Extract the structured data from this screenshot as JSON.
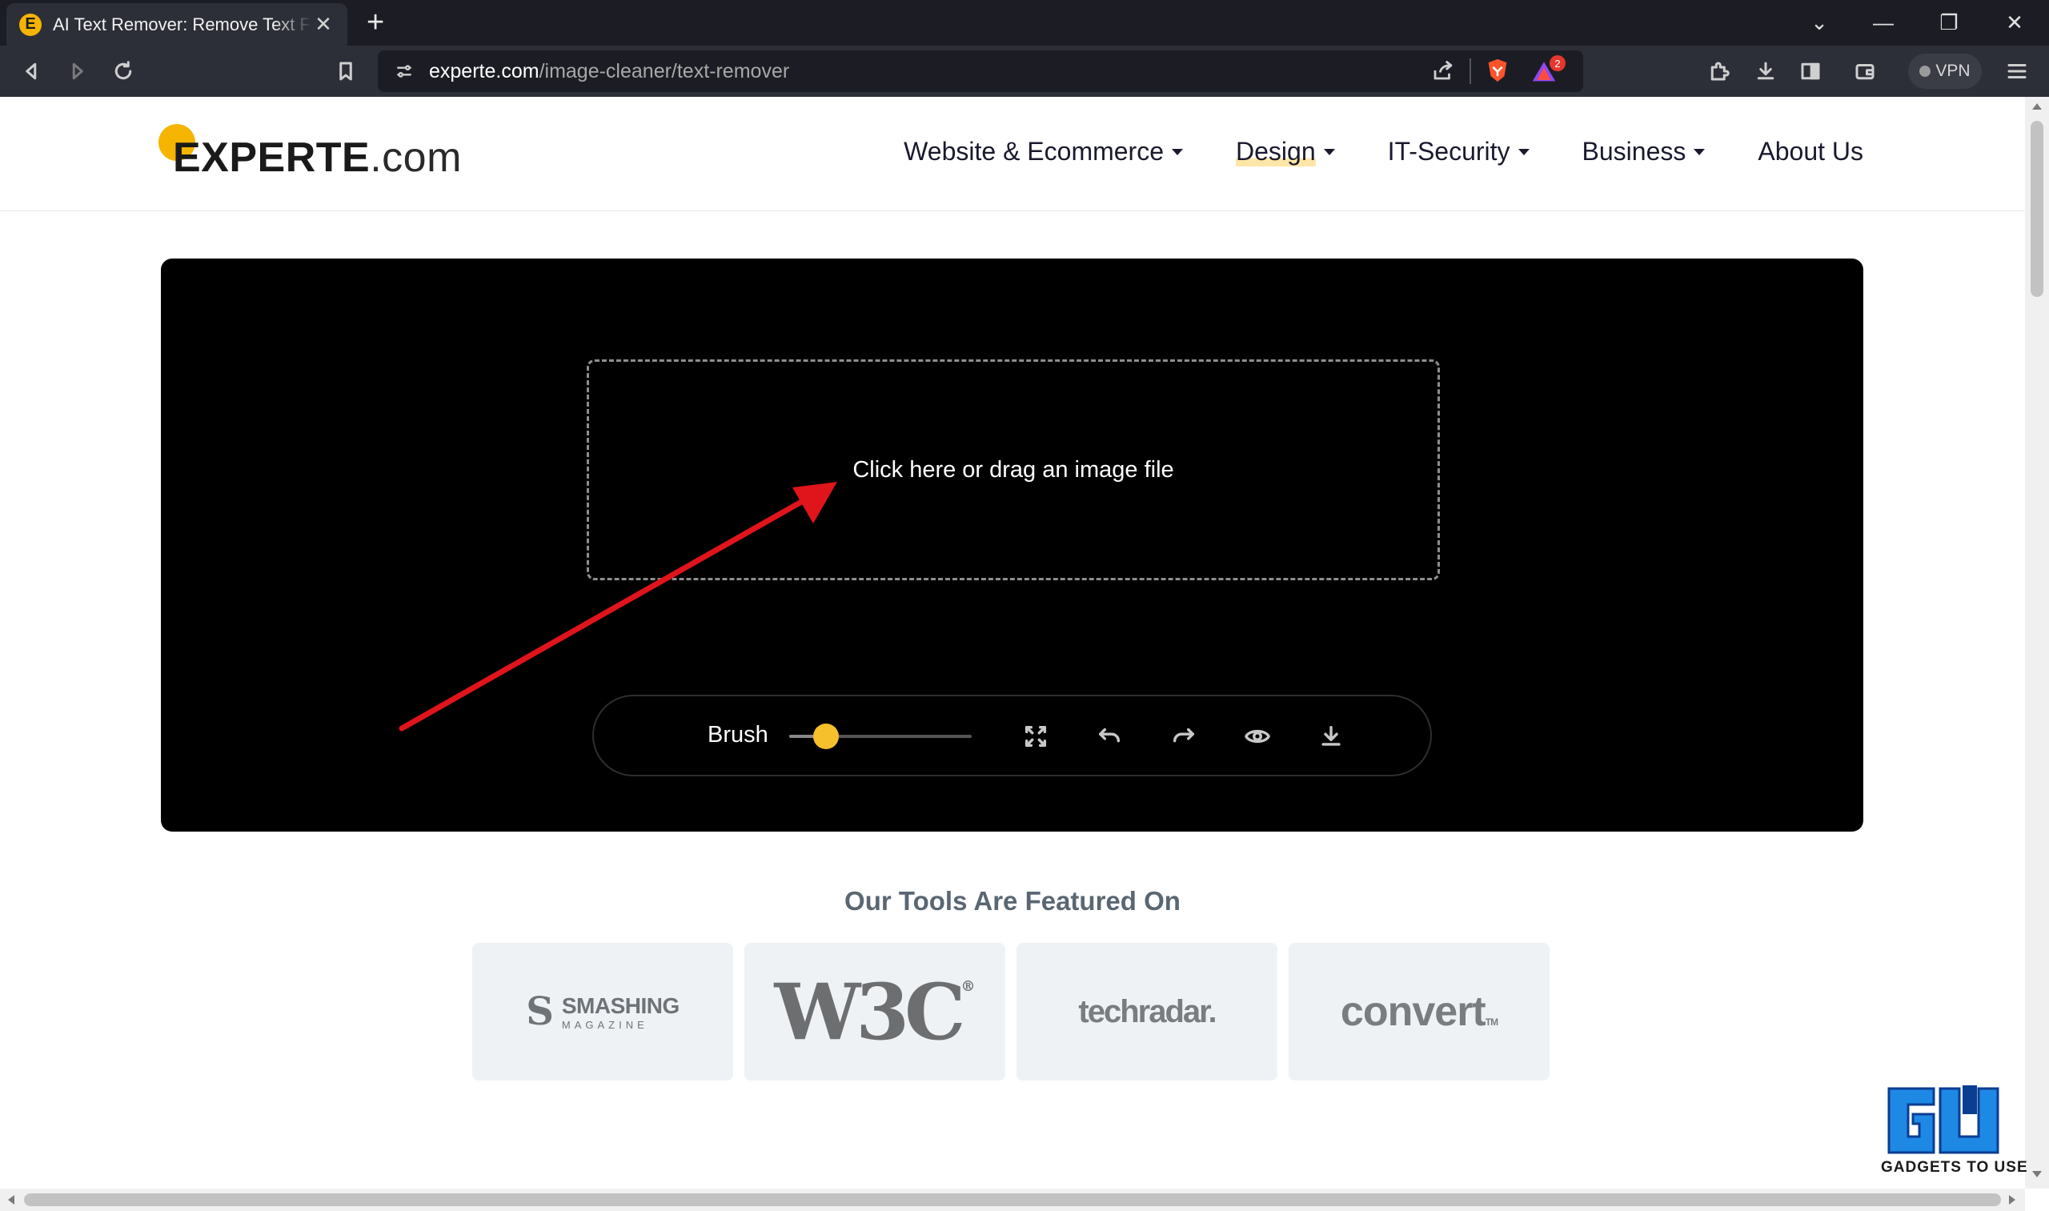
{
  "browser": {
    "tab": {
      "favicon_letter": "E",
      "title": "AI Text Remover: Remove Text From Images",
      "close_glyph": "✕"
    },
    "new_tab_glyph": "+",
    "window_controls": [
      "⌄",
      "—",
      "❐",
      "✕"
    ],
    "address": {
      "host": "experte.com",
      "path": "/image-cleaner/text-remover"
    },
    "shields_badge": "2",
    "vpn_label": "VPN",
    "icons": [
      "back-icon",
      "forward-icon",
      "reload-icon",
      "bookmark-icon",
      "site-info-icon",
      "share-icon",
      "brave-shield-icon",
      "brave-rewards-icon",
      "extensions-icon",
      "downloads-icon",
      "sidebar-icon",
      "wallet-icon",
      "menu-icon"
    ]
  },
  "site": {
    "logo": {
      "strong": "EXPERTE",
      "tld": ".com"
    },
    "nav": [
      {
        "label": "Website & Ecommerce",
        "has_menu": true
      },
      {
        "label": "Design",
        "has_menu": true,
        "active": true
      },
      {
        "label": "IT-Security",
        "has_menu": true
      },
      {
        "label": "Business",
        "has_menu": true
      },
      {
        "label": "About Us",
        "has_menu": false
      }
    ],
    "accent_color": "#f5b400"
  },
  "editor": {
    "dropzone_text": "Click here or drag an image file",
    "brush_label": "Brush",
    "brush_size_fraction": 0.2,
    "tool_icons": [
      "fit-screen-icon",
      "undo-icon",
      "redo-icon",
      "preview-eye-icon",
      "download-icon"
    ],
    "annotation_arrow_color": "#e0141b"
  },
  "featured": {
    "title": "Our Tools Are Featured On",
    "logos": [
      {
        "name": "smashing-magazine",
        "mark": "S",
        "top": "SMASHING",
        "bottom": "MAGAZINE"
      },
      {
        "name": "w3c",
        "text": "W3C",
        "reg": "®"
      },
      {
        "name": "techradar",
        "text": "techradar."
      },
      {
        "name": "convert",
        "text": "convert",
        "tm": "TM"
      }
    ]
  },
  "watermark": {
    "text": "GADGETS TO USE"
  }
}
